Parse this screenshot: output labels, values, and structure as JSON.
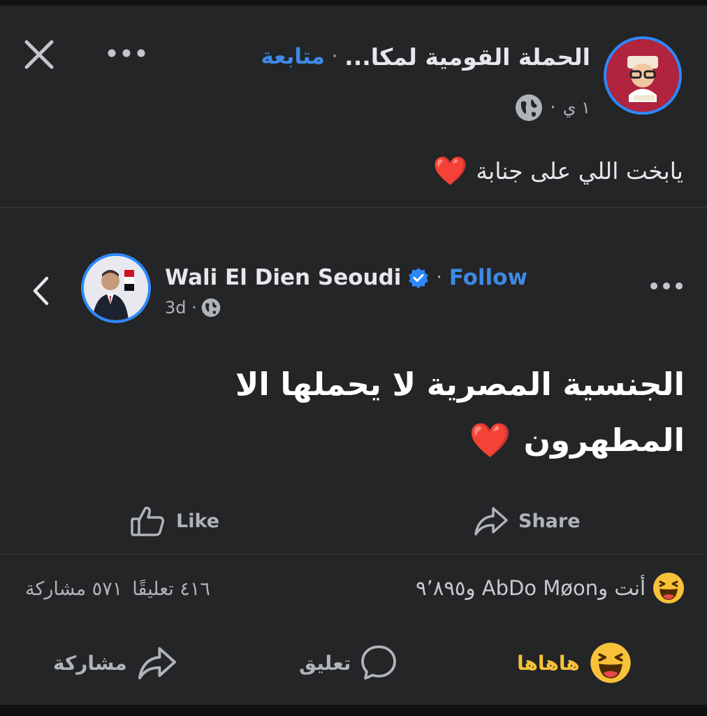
{
  "header": {
    "page_name": "الحملة القومية لمكا...",
    "follow_label": "متابعة",
    "separator": "·",
    "time": "١ ي",
    "close_icon": "close-icon",
    "more_icon": "more-icon",
    "globe_icon": "globe-icon"
  },
  "post": {
    "text": "يابخت اللي على جنابة",
    "emoji": "❤️"
  },
  "shared_post": {
    "back_icon": "chevron-left-icon",
    "author": "Wali El Dien Seoudi",
    "verified_icon": "verified-badge-icon",
    "separator": "·",
    "follow_label": "Follow",
    "time": "3d ·",
    "text_line1": "الجنسية المصرية لا يحملها الا",
    "text_line2": "المطهرون",
    "emoji": "❤️",
    "like_label": "Like",
    "share_label": "Share"
  },
  "stats": {
    "reactions_text": "أنت وAbDo Møon و٩٬٨٩٥",
    "comments_text": "٤١٦ تعليقًا",
    "shares_text": "٥٧١ مشاركة"
  },
  "actions": {
    "haha_label": "هاهاها",
    "comment_label": "تعليق",
    "share_label": "مشاركة"
  },
  "colors": {
    "background": "#242526",
    "accent": "#3d8ae6",
    "haha": "#f7c23a",
    "text": "#e6e7eb",
    "muted": "#b0b3b8"
  }
}
